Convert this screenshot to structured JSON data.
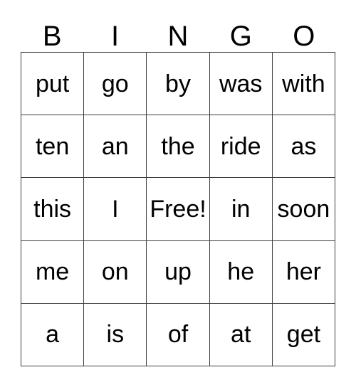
{
  "card": {
    "title_letters": [
      "B",
      "I",
      "N",
      "G",
      "O"
    ],
    "free_space_label": "Free!",
    "colors": {
      "background": "#ffffff",
      "grid_line": "#3c3c3c",
      "text": "#000000"
    },
    "rows": [
      {
        "cells": [
          "put",
          "go",
          "by",
          "was",
          "with"
        ]
      },
      {
        "cells": [
          "ten",
          "an",
          "the",
          "ride",
          "as"
        ]
      },
      {
        "cells": [
          "this",
          "I",
          "Free!",
          "in",
          "soon"
        ]
      },
      {
        "cells": [
          "me",
          "on",
          "up",
          "he",
          "her"
        ]
      },
      {
        "cells": [
          "a",
          "is",
          "of",
          "at",
          "get"
        ]
      }
    ]
  }
}
